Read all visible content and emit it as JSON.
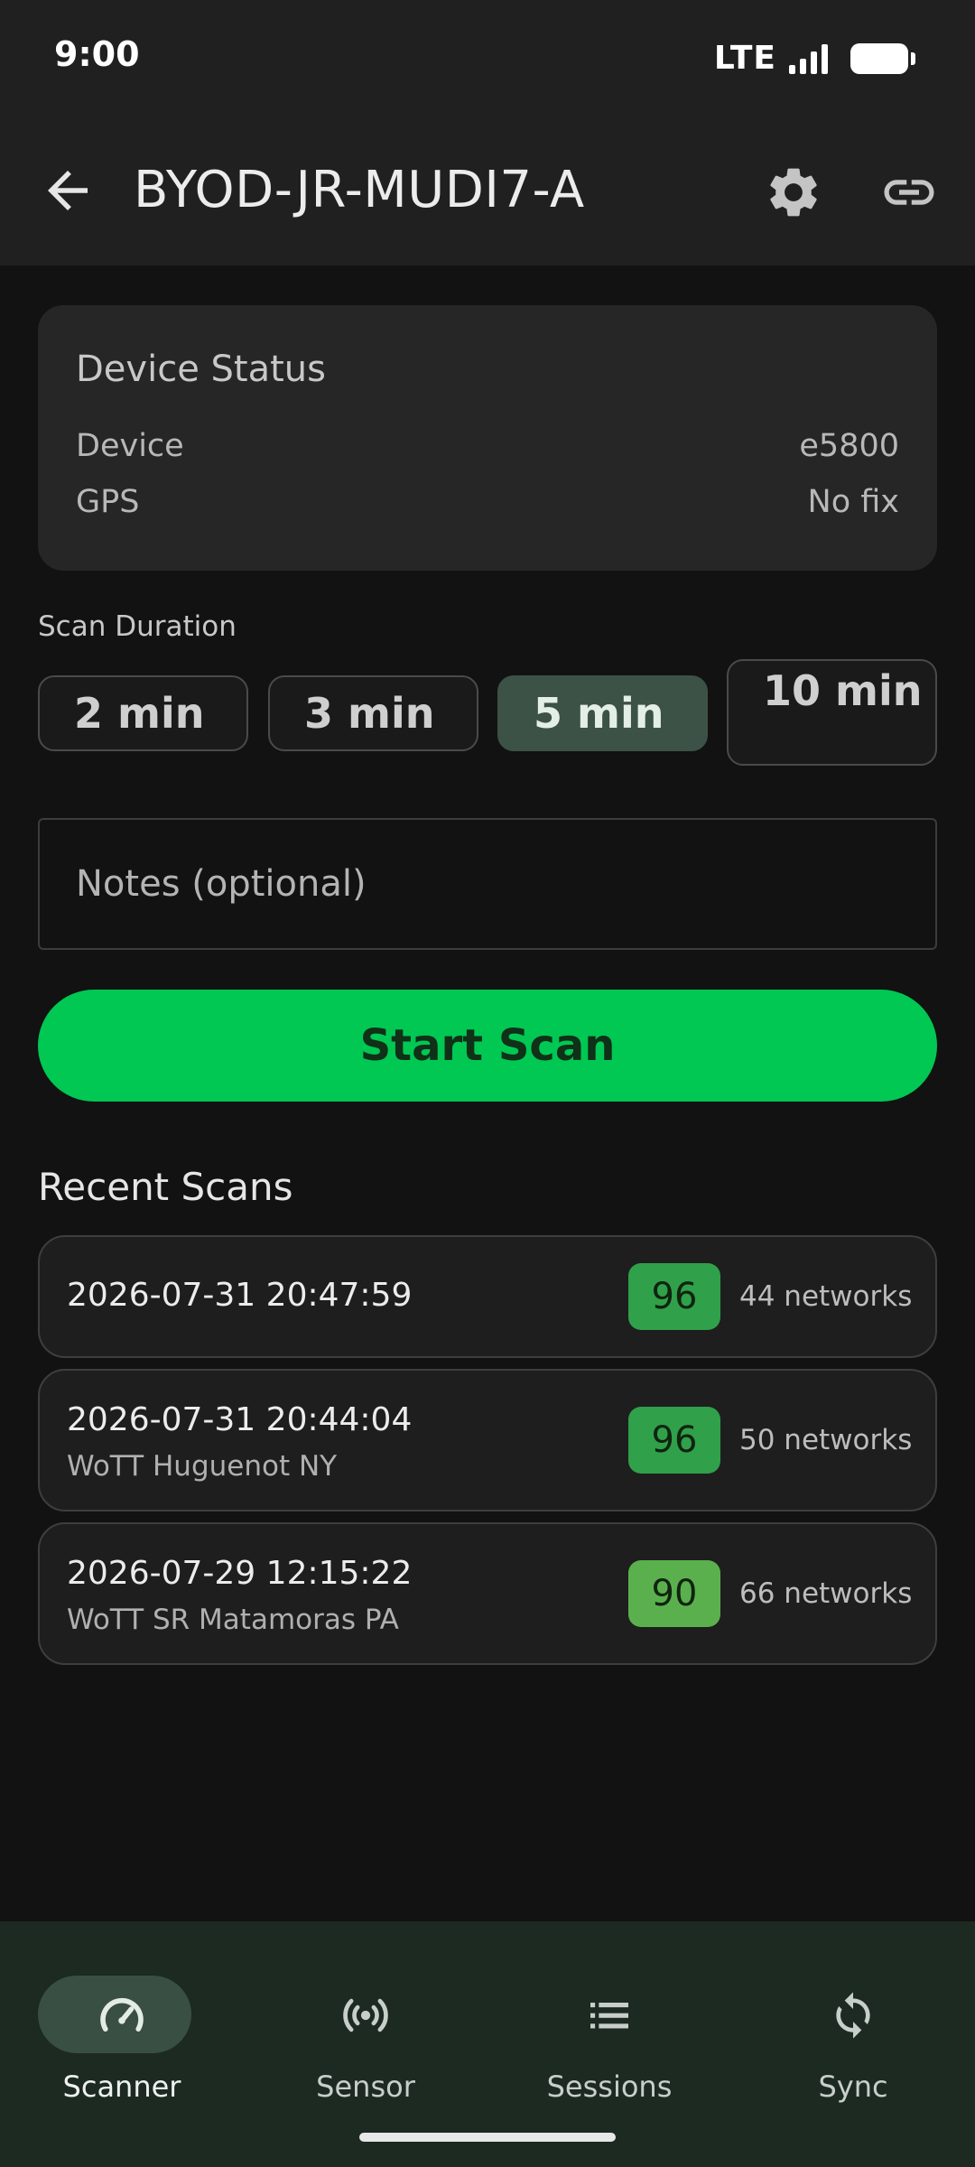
{
  "status_bar": {
    "time": "9:00",
    "network": "LTE"
  },
  "app_bar": {
    "title": "BYOD-JR-MUDI7-A",
    "icons": [
      "arrow-back-icon",
      "gear-icon",
      "link-icon"
    ]
  },
  "device_status": {
    "title": "Device Status",
    "rows": [
      {
        "label": "Device",
        "value": "e5800"
      },
      {
        "label": "GPS",
        "value": "No fix"
      }
    ]
  },
  "scan_duration": {
    "label": "Scan Duration",
    "options": [
      {
        "label": "2 min",
        "selected": false
      },
      {
        "label": "3 min",
        "selected": false
      },
      {
        "label": "5 min",
        "selected": true
      },
      {
        "label": "10 min",
        "selected": false
      }
    ]
  },
  "notes": {
    "placeholder": "Notes (optional)",
    "value": ""
  },
  "start_button": {
    "label": "Start Scan",
    "color": "#00c853"
  },
  "recent_scans": {
    "title": "Recent Scans",
    "items": [
      {
        "date": "2026-07-31 20:47:59",
        "location": "",
        "score": "96",
        "networks": "44 networks",
        "score_color": "#30a04a"
      },
      {
        "date": "2026-07-31 20:44:04",
        "location": "WoTT Huguenot NY",
        "score": "96",
        "networks": "50 networks",
        "score_color": "#30a04a"
      },
      {
        "date": "2026-07-29 12:15:22",
        "location": "WoTT SR Matamoras PA",
        "score": "90",
        "networks": "66 networks",
        "score_color": "#5bb04e"
      }
    ]
  },
  "bottom_nav": {
    "items": [
      {
        "label": "Scanner",
        "icon": "speedometer-icon",
        "active": true
      },
      {
        "label": "Sensor",
        "icon": "broadcast-icon",
        "active": false
      },
      {
        "label": "Sessions",
        "icon": "list-icon",
        "active": false
      },
      {
        "label": "Sync",
        "icon": "sync-icon",
        "active": false
      }
    ]
  }
}
